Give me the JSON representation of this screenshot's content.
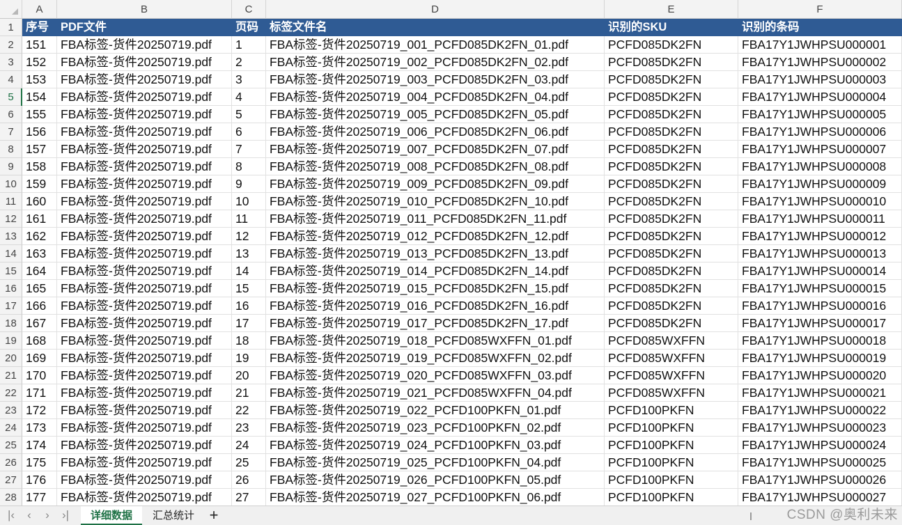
{
  "columns": [
    {
      "letter": "A"
    },
    {
      "letter": "B"
    },
    {
      "letter": "C"
    },
    {
      "letter": "D"
    },
    {
      "letter": "E"
    },
    {
      "letter": "F"
    }
  ],
  "headers": [
    "序号",
    "PDF文件",
    "页码",
    "标签文件名",
    "识别的SKU",
    "识别的条码"
  ],
  "row_numbers": [
    "1",
    "2",
    "3",
    "4",
    "5",
    "6",
    "7",
    "8",
    "9",
    "10",
    "11",
    "12",
    "13",
    "14",
    "15",
    "16",
    "17",
    "18",
    "19",
    "20",
    "21",
    "22",
    "23",
    "24",
    "25",
    "26",
    "27",
    "28"
  ],
  "active_row_number": "5",
  "rows": [
    [
      "151",
      "FBA标签-货件20250719.pdf",
      "1",
      "FBA标签-货件20250719_001_PCFD085DK2FN_01.pdf",
      "PCFD085DK2FN",
      "FBA17Y1JWHPSU000001"
    ],
    [
      "152",
      "FBA标签-货件20250719.pdf",
      "2",
      "FBA标签-货件20250719_002_PCFD085DK2FN_02.pdf",
      "PCFD085DK2FN",
      "FBA17Y1JWHPSU000002"
    ],
    [
      "153",
      "FBA标签-货件20250719.pdf",
      "3",
      "FBA标签-货件20250719_003_PCFD085DK2FN_03.pdf",
      "PCFD085DK2FN",
      "FBA17Y1JWHPSU000003"
    ],
    [
      "154",
      "FBA标签-货件20250719.pdf",
      "4",
      "FBA标签-货件20250719_004_PCFD085DK2FN_04.pdf",
      "PCFD085DK2FN",
      "FBA17Y1JWHPSU000004"
    ],
    [
      "155",
      "FBA标签-货件20250719.pdf",
      "5",
      "FBA标签-货件20250719_005_PCFD085DK2FN_05.pdf",
      "PCFD085DK2FN",
      "FBA17Y1JWHPSU000005"
    ],
    [
      "156",
      "FBA标签-货件20250719.pdf",
      "6",
      "FBA标签-货件20250719_006_PCFD085DK2FN_06.pdf",
      "PCFD085DK2FN",
      "FBA17Y1JWHPSU000006"
    ],
    [
      "157",
      "FBA标签-货件20250719.pdf",
      "7",
      "FBA标签-货件20250719_007_PCFD085DK2FN_07.pdf",
      "PCFD085DK2FN",
      "FBA17Y1JWHPSU000007"
    ],
    [
      "158",
      "FBA标签-货件20250719.pdf",
      "8",
      "FBA标签-货件20250719_008_PCFD085DK2FN_08.pdf",
      "PCFD085DK2FN",
      "FBA17Y1JWHPSU000008"
    ],
    [
      "159",
      "FBA标签-货件20250719.pdf",
      "9",
      "FBA标签-货件20250719_009_PCFD085DK2FN_09.pdf",
      "PCFD085DK2FN",
      "FBA17Y1JWHPSU000009"
    ],
    [
      "160",
      "FBA标签-货件20250719.pdf",
      "10",
      "FBA标签-货件20250719_010_PCFD085DK2FN_10.pdf",
      "PCFD085DK2FN",
      "FBA17Y1JWHPSU000010"
    ],
    [
      "161",
      "FBA标签-货件20250719.pdf",
      "11",
      "FBA标签-货件20250719_011_PCFD085DK2FN_11.pdf",
      "PCFD085DK2FN",
      "FBA17Y1JWHPSU000011"
    ],
    [
      "162",
      "FBA标签-货件20250719.pdf",
      "12",
      "FBA标签-货件20250719_012_PCFD085DK2FN_12.pdf",
      "PCFD085DK2FN",
      "FBA17Y1JWHPSU000012"
    ],
    [
      "163",
      "FBA标签-货件20250719.pdf",
      "13",
      "FBA标签-货件20250719_013_PCFD085DK2FN_13.pdf",
      "PCFD085DK2FN",
      "FBA17Y1JWHPSU000013"
    ],
    [
      "164",
      "FBA标签-货件20250719.pdf",
      "14",
      "FBA标签-货件20250719_014_PCFD085DK2FN_14.pdf",
      "PCFD085DK2FN",
      "FBA17Y1JWHPSU000014"
    ],
    [
      "165",
      "FBA标签-货件20250719.pdf",
      "15",
      "FBA标签-货件20250719_015_PCFD085DK2FN_15.pdf",
      "PCFD085DK2FN",
      "FBA17Y1JWHPSU000015"
    ],
    [
      "166",
      "FBA标签-货件20250719.pdf",
      "16",
      "FBA标签-货件20250719_016_PCFD085DK2FN_16.pdf",
      "PCFD085DK2FN",
      "FBA17Y1JWHPSU000016"
    ],
    [
      "167",
      "FBA标签-货件20250719.pdf",
      "17",
      "FBA标签-货件20250719_017_PCFD085DK2FN_17.pdf",
      "PCFD085DK2FN",
      "FBA17Y1JWHPSU000017"
    ],
    [
      "168",
      "FBA标签-货件20250719.pdf",
      "18",
      "FBA标签-货件20250719_018_PCFD085WXFFN_01.pdf",
      "PCFD085WXFFN",
      "FBA17Y1JWHPSU000018"
    ],
    [
      "169",
      "FBA标签-货件20250719.pdf",
      "19",
      "FBA标签-货件20250719_019_PCFD085WXFFN_02.pdf",
      "PCFD085WXFFN",
      "FBA17Y1JWHPSU000019"
    ],
    [
      "170",
      "FBA标签-货件20250719.pdf",
      "20",
      "FBA标签-货件20250719_020_PCFD085WXFFN_03.pdf",
      "PCFD085WXFFN",
      "FBA17Y1JWHPSU000020"
    ],
    [
      "171",
      "FBA标签-货件20250719.pdf",
      "21",
      "FBA标签-货件20250719_021_PCFD085WXFFN_04.pdf",
      "PCFD085WXFFN",
      "FBA17Y1JWHPSU000021"
    ],
    [
      "172",
      "FBA标签-货件20250719.pdf",
      "22",
      "FBA标签-货件20250719_022_PCFD100PKFN_01.pdf",
      "PCFD100PKFN",
      "FBA17Y1JWHPSU000022"
    ],
    [
      "173",
      "FBA标签-货件20250719.pdf",
      "23",
      "FBA标签-货件20250719_023_PCFD100PKFN_02.pdf",
      "PCFD100PKFN",
      "FBA17Y1JWHPSU000023"
    ],
    [
      "174",
      "FBA标签-货件20250719.pdf",
      "24",
      "FBA标签-货件20250719_024_PCFD100PKFN_03.pdf",
      "PCFD100PKFN",
      "FBA17Y1JWHPSU000024"
    ],
    [
      "175",
      "FBA标签-货件20250719.pdf",
      "25",
      "FBA标签-货件20250719_025_PCFD100PKFN_04.pdf",
      "PCFD100PKFN",
      "FBA17Y1JWHPSU000025"
    ],
    [
      "176",
      "FBA标签-货件20250719.pdf",
      "26",
      "FBA标签-货件20250719_026_PCFD100PKFN_05.pdf",
      "PCFD100PKFN",
      "FBA17Y1JWHPSU000026"
    ],
    [
      "177",
      "FBA标签-货件20250719.pdf",
      "27",
      "FBA标签-货件20250719_027_PCFD100PKFN_06.pdf",
      "PCFD100PKFN",
      "FBA17Y1JWHPSU000027"
    ]
  ],
  "sheet_tabs": [
    {
      "label": "详细数据",
      "active": true
    },
    {
      "label": "汇总统计",
      "active": false
    }
  ],
  "nav_icons": [
    "first-sheet-icon",
    "prev-sheet-icon",
    "next-sheet-icon",
    "last-sheet-icon"
  ],
  "add_sheet_icon": "plus-icon",
  "watermark": "CSDN @奥利未来",
  "colors": {
    "header_fill": "#2f5b94",
    "header_text": "#ffffff",
    "active_tab": "#1e7145"
  }
}
